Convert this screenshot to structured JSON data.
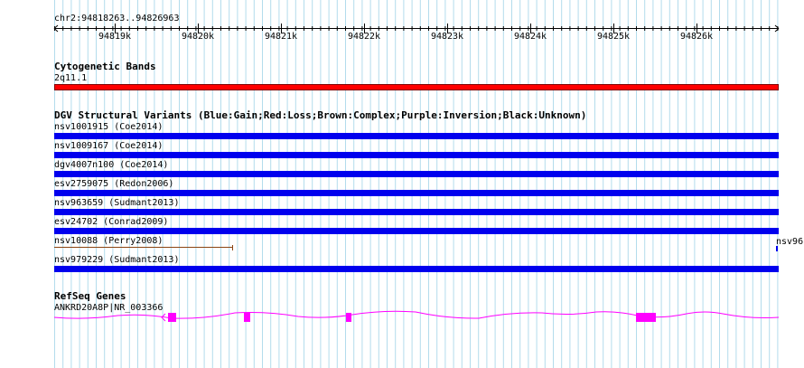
{
  "ruler": {
    "label": "chr2:94818263..94826963",
    "ticks": [
      "94819k",
      "94820k",
      "94821k",
      "94822k",
      "94823k",
      "94824k",
      "94825k",
      "94826k"
    ]
  },
  "cyto": {
    "title": "Cytogenetic Bands",
    "band": "2q11.1",
    "color": "#ff0000"
  },
  "dgv": {
    "title": "DGV Structural Variants (Blue:Gain;Red:Loss;Brown:Complex;Purple:Inversion;Black:Unknown)",
    "gain_color": "#0000ee",
    "complex_color": "#8b4513",
    "tracks": [
      {
        "label": "nsv1001915 (Coe2014)",
        "type": "gain"
      },
      {
        "label": "nsv1009167 (Coe2014)",
        "type": "gain"
      },
      {
        "label": "dgv4007n100 (Coe2014)",
        "type": "gain"
      },
      {
        "label": "esv2759075 (Redon2006)",
        "type": "gain"
      },
      {
        "label": "nsv963659 (Sudmant2013)",
        "type": "gain"
      },
      {
        "label": "esv24702 (Conrad2009)",
        "type": "gain"
      },
      {
        "label": "nsv10088 (Perry2008)",
        "type": "complex"
      },
      {
        "label": "nsv979229 (Sudmant2013)",
        "type": "gain"
      }
    ],
    "edge_label": "nsv96"
  },
  "genes": {
    "title": "RefSeq Genes",
    "gene_label": "ANKRD20A8P|NR_003366",
    "color": "#ff00ff"
  }
}
